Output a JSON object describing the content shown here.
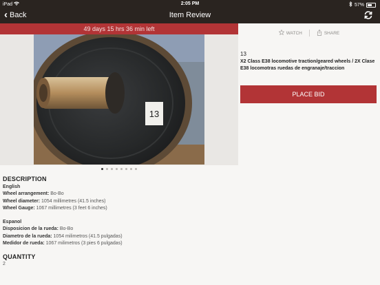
{
  "status_bar": {
    "device": "iPad",
    "time": "2:05 PM",
    "battery": "57%",
    "battery_level": 0.57
  },
  "nav": {
    "back_label": "Back",
    "title": "Item Review"
  },
  "timer": {
    "text": "49 days 15 hrs 36 min left"
  },
  "actions": {
    "watch_label": "WATCH",
    "share_label": "SHARE"
  },
  "item": {
    "lot_number": "13",
    "title": "X2 Class E38 locomotive traction/geared wheels / 2X Clase E38 locomotras ruedas de engranaje/traccion",
    "photo_tag": "13",
    "bid_label": "PLACE BID"
  },
  "gallery": {
    "dot_count": 8,
    "active_index": 0
  },
  "description": {
    "heading": "DESCRIPTION",
    "english": {
      "label": "English",
      "rows": [
        {
          "key": "Wheel arrangement:",
          "value": "Bo-Bo"
        },
        {
          "key": "Wheel diameter:",
          "value": "1054 millimetres (41.5 inches)"
        },
        {
          "key": "Wheel Gauge:",
          "value": "1067 millimetres (3 feet 6 inches)"
        }
      ]
    },
    "spanish": {
      "label": "Espanol",
      "rows": [
        {
          "key": "Disposicion de la rueda:",
          "value": "Bo-Bo"
        },
        {
          "key": "Diametro de la rueda:",
          "value": "1054 milimetros (41.5 pulgadas)"
        },
        {
          "key": "Medidor de rueda:",
          "value": "1067 milimetros (3 pies 6 pulgadas)"
        }
      ]
    }
  },
  "quantity": {
    "heading": "QUANTITY",
    "value": "2"
  },
  "colors": {
    "accent": "#b23436",
    "bar": "#2a2420"
  }
}
